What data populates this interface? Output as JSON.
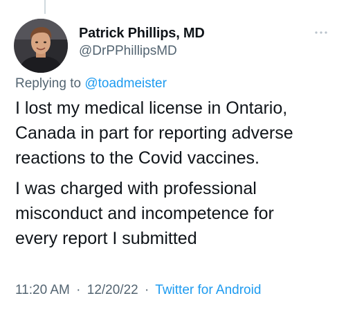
{
  "author": {
    "display_name": "Patrick Phillips, MD",
    "handle": "@DrPPhillipsMD",
    "avatar_icon": "avatar-photo"
  },
  "reply": {
    "prefix": "Replying to",
    "mention": "@toadmeister"
  },
  "tweet": {
    "paragraphs": [
      "I lost my medical license in Ontario,\nCanada in part for reporting adverse\nreactions to the Covid vaccines.",
      "I was charged with professional\nmisconduct and incompetence for\nevery report I submitted"
    ]
  },
  "meta": {
    "time": "11:20 AM",
    "date": "12/20/22",
    "source": "Twitter for Android",
    "separator": "·"
  },
  "icons": {
    "more": "more-options-icon"
  },
  "colors": {
    "text_primary": "#0f1419",
    "text_secondary": "#536471",
    "link": "#1d9bf0",
    "thread_line": "#cfd9de"
  }
}
